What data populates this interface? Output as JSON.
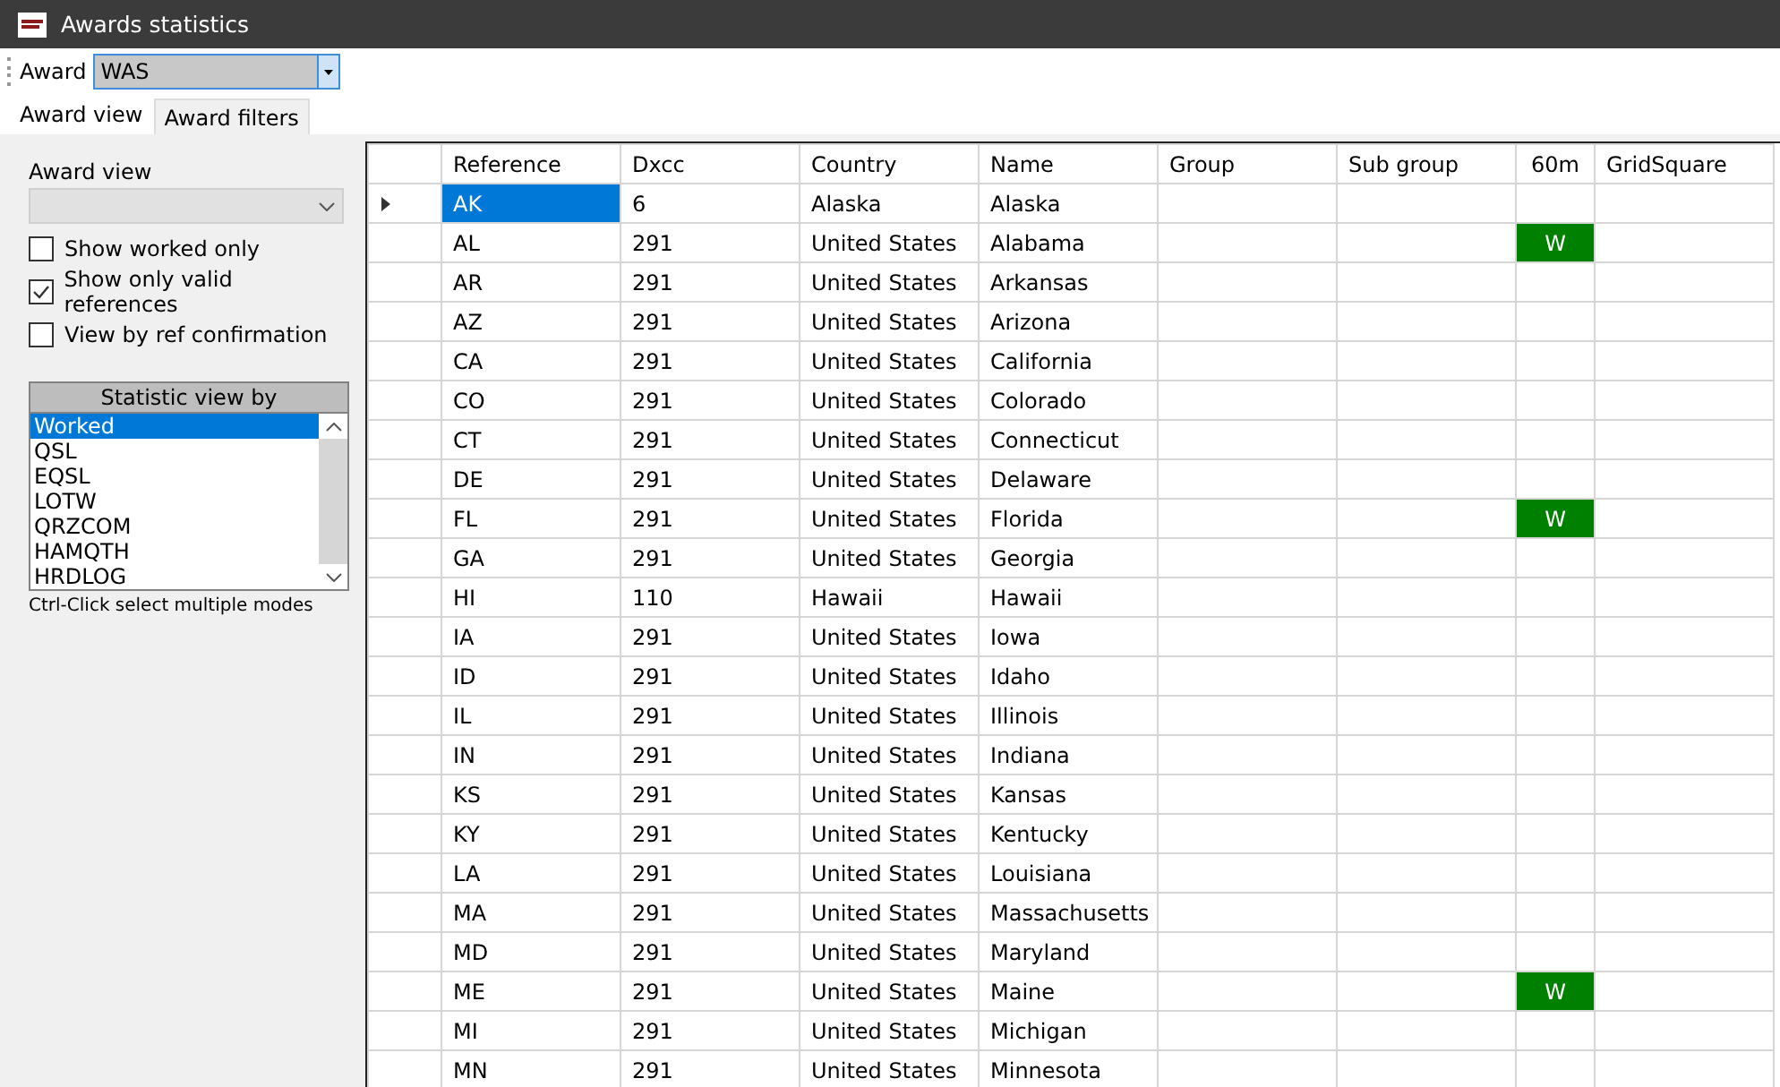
{
  "window": {
    "title": "Awards statistics"
  },
  "toolbar": {
    "label": "Award",
    "value": "WAS"
  },
  "tabs": [
    {
      "label": "Award view",
      "selected": true
    },
    {
      "label": "Award filters",
      "selected": false
    }
  ],
  "panel": {
    "award_view_label": "Award view",
    "checkboxes": [
      {
        "label": "Show worked only",
        "checked": false
      },
      {
        "label": "Show only valid references",
        "checked": true
      },
      {
        "label": "View by ref confirmation",
        "checked": false
      }
    ],
    "list_header": "Statistic view by",
    "list_items": [
      {
        "label": "Worked",
        "selected": true
      },
      {
        "label": "QSL",
        "selected": false
      },
      {
        "label": "EQSL",
        "selected": false
      },
      {
        "label": "LOTW",
        "selected": false
      },
      {
        "label": "QRZCOM",
        "selected": false
      },
      {
        "label": "HAMQTH",
        "selected": false
      },
      {
        "label": "HRDLOG",
        "selected": false
      }
    ],
    "hint": "Ctrl-Click select multiple modes"
  },
  "table": {
    "columns": [
      "Reference",
      "Dxcc",
      "Country",
      "Name",
      "Group",
      "Sub group",
      "60m",
      "GridSquare"
    ],
    "rows": [
      {
        "selected": true,
        "reference": "AK",
        "dxcc": "6",
        "country": "Alaska",
        "name": "Alaska",
        "band_60m": ""
      },
      {
        "selected": false,
        "reference": "AL",
        "dxcc": "291",
        "country": "United States",
        "name": "Alabama",
        "band_60m": "W"
      },
      {
        "selected": false,
        "reference": "AR",
        "dxcc": "291",
        "country": "United States",
        "name": "Arkansas",
        "band_60m": ""
      },
      {
        "selected": false,
        "reference": "AZ",
        "dxcc": "291",
        "country": "United States",
        "name": "Arizona",
        "band_60m": ""
      },
      {
        "selected": false,
        "reference": "CA",
        "dxcc": "291",
        "country": "United States",
        "name": "California",
        "band_60m": ""
      },
      {
        "selected": false,
        "reference": "CO",
        "dxcc": "291",
        "country": "United States",
        "name": "Colorado",
        "band_60m": ""
      },
      {
        "selected": false,
        "reference": "CT",
        "dxcc": "291",
        "country": "United States",
        "name": "Connecticut",
        "band_60m": ""
      },
      {
        "selected": false,
        "reference": "DE",
        "dxcc": "291",
        "country": "United States",
        "name": "Delaware",
        "band_60m": ""
      },
      {
        "selected": false,
        "reference": "FL",
        "dxcc": "291",
        "country": "United States",
        "name": "Florida",
        "band_60m": "W"
      },
      {
        "selected": false,
        "reference": "GA",
        "dxcc": "291",
        "country": "United States",
        "name": "Georgia",
        "band_60m": ""
      },
      {
        "selected": false,
        "reference": "HI",
        "dxcc": "110",
        "country": "Hawaii",
        "name": "Hawaii",
        "band_60m": ""
      },
      {
        "selected": false,
        "reference": "IA",
        "dxcc": "291",
        "country": "United States",
        "name": "Iowa",
        "band_60m": ""
      },
      {
        "selected": false,
        "reference": "ID",
        "dxcc": "291",
        "country": "United States",
        "name": "Idaho",
        "band_60m": ""
      },
      {
        "selected": false,
        "reference": "IL",
        "dxcc": "291",
        "country": "United States",
        "name": "Illinois",
        "band_60m": ""
      },
      {
        "selected": false,
        "reference": "IN",
        "dxcc": "291",
        "country": "United States",
        "name": "Indiana",
        "band_60m": ""
      },
      {
        "selected": false,
        "reference": "KS",
        "dxcc": "291",
        "country": "United States",
        "name": "Kansas",
        "band_60m": ""
      },
      {
        "selected": false,
        "reference": "KY",
        "dxcc": "291",
        "country": "United States",
        "name": "Kentucky",
        "band_60m": ""
      },
      {
        "selected": false,
        "reference": "LA",
        "dxcc": "291",
        "country": "United States",
        "name": "Louisiana",
        "band_60m": ""
      },
      {
        "selected": false,
        "reference": "MA",
        "dxcc": "291",
        "country": "United States",
        "name": "Massachusetts",
        "band_60m": ""
      },
      {
        "selected": false,
        "reference": "MD",
        "dxcc": "291",
        "country": "United States",
        "name": "Maryland",
        "band_60m": ""
      },
      {
        "selected": false,
        "reference": "ME",
        "dxcc": "291",
        "country": "United States",
        "name": "Maine",
        "band_60m": "W"
      },
      {
        "selected": false,
        "reference": "MI",
        "dxcc": "291",
        "country": "United States",
        "name": "Michigan",
        "band_60m": ""
      },
      {
        "selected": false,
        "reference": "MN",
        "dxcc": "291",
        "country": "United States",
        "name": "Minnesota",
        "band_60m": ""
      }
    ]
  }
}
